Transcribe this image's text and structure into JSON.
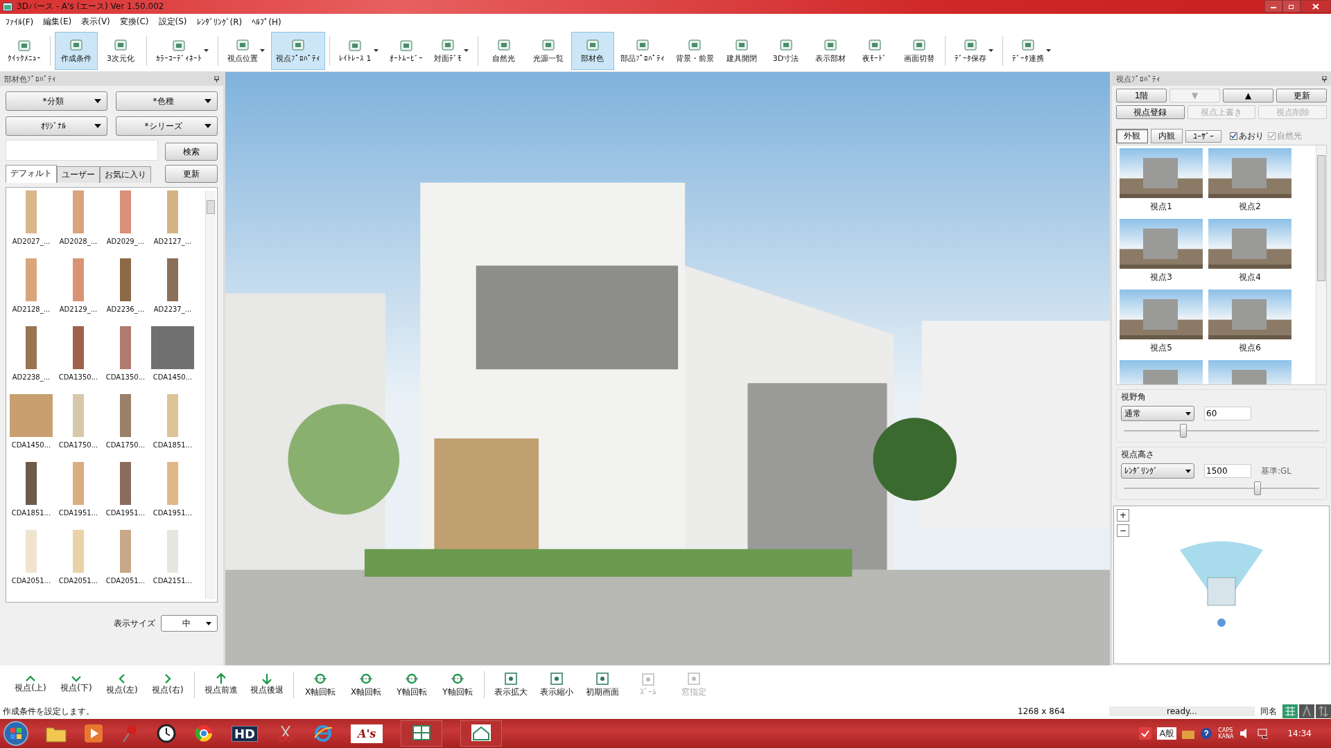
{
  "window": {
    "title": "3Dパース - A's (エース) Ver 1.50.002"
  },
  "menu": [
    "ﾌｧｲﾙ(F)",
    "編集(E)",
    "表示(V)",
    "変換(C)",
    "設定(S)",
    "ﾚﾝﾀﾞﾘﾝｸﾞ(R)",
    "ﾍﾙﾌﾟ(H)"
  ],
  "toolbar": [
    [
      {
        "label": "ｸｲｯｸﾒﾆｭｰ",
        "selected": false,
        "dropdown": false
      }
    ],
    [
      {
        "label": "作成条件",
        "selected": true,
        "dropdown": false
      },
      {
        "label": "3次元化",
        "selected": false,
        "dropdown": false
      }
    ],
    [
      {
        "label": "ｶﾗｰｺｰﾃﾞｨﾈｰﾄ",
        "selected": false,
        "dropdown": true
      }
    ],
    [
      {
        "label": "視点位置",
        "selected": false,
        "dropdown": true
      },
      {
        "label": "視点ﾌﾟﾛﾊﾟﾃｨ",
        "selected": true,
        "dropdown": false
      }
    ],
    [
      {
        "label": "ﾚｲﾄﾚｰｽ 1",
        "selected": false,
        "dropdown": true
      },
      {
        "label": "ｵｰﾄﾑｰﾋﾞｰ",
        "selected": false,
        "dropdown": false
      },
      {
        "label": "対面ﾃﾞﾓ",
        "selected": false,
        "dropdown": true
      }
    ],
    [
      {
        "label": "自然光",
        "selected": false,
        "dropdown": false
      },
      {
        "label": "光源一覧",
        "selected": false,
        "dropdown": false
      },
      {
        "label": "部材色",
        "selected": true,
        "dropdown": false
      },
      {
        "label": "部品ﾌﾟﾛﾊﾟﾃｨ",
        "selected": false,
        "dropdown": false
      },
      {
        "label": "背景・前景",
        "selected": false,
        "dropdown": false
      },
      {
        "label": "建具開閉",
        "selected": false,
        "dropdown": false
      },
      {
        "label": "3D寸法",
        "selected": false,
        "dropdown": false
      },
      {
        "label": "表示部材",
        "selected": false,
        "dropdown": false
      },
      {
        "label": "夜ﾓｰﾄﾞ",
        "selected": false,
        "dropdown": false
      },
      {
        "label": "画面切替",
        "selected": false,
        "dropdown": false
      }
    ],
    [
      {
        "label": "ﾃﾞｰﾀ保存",
        "selected": false,
        "dropdown": true
      }
    ],
    [
      {
        "label": "ﾃﾞｰﾀ連携",
        "selected": false,
        "dropdown": true
      }
    ]
  ],
  "left_panel": {
    "title": "部材色ﾌﾟﾛﾊﾟﾃｨ",
    "dropdowns": [
      "*分類",
      "*色種",
      "ｵﾘｼﾞﾅﾙ",
      "*シリーズ"
    ],
    "search_button": "検索",
    "refresh_button": "更新",
    "tabs": [
      {
        "label": "デフォルト",
        "selected": true
      },
      {
        "label": "ユーザー",
        "selected": false
      },
      {
        "label": "お気に入り",
        "selected": false
      }
    ],
    "swatches": [
      {
        "label": "AD2027_...",
        "color": "#d8b88a",
        "kind": "strip"
      },
      {
        "label": "AD2028_...",
        "color": "#d9a47c",
        "kind": "strip"
      },
      {
        "label": "AD2029_...",
        "color": "#d98f78",
        "kind": "strip"
      },
      {
        "label": "AD2127_...",
        "color": "#d6b384",
        "kind": "strip"
      },
      {
        "label": "AD2128_...",
        "color": "#d9a67c",
        "kind": "strip"
      },
      {
        "label": "AD2129_...",
        "color": "#d99475",
        "kind": "strip"
      },
      {
        "label": "AD2236_...",
        "color": "#8c6a48",
        "kind": "strip"
      },
      {
        "label": "AD2237_...",
        "color": "#8a7058",
        "kind": "strip"
      },
      {
        "label": "AD2238_...",
        "color": "#9a7450",
        "kind": "strip"
      },
      {
        "label": "CDA1350...",
        "color": "#a0604c",
        "kind": "strip"
      },
      {
        "label": "CDA1350...",
        "color": "#b07a6e",
        "kind": "strip"
      },
      {
        "label": "CDA1450...",
        "color": "#707070",
        "kind": "full"
      },
      {
        "label": "CDA1450...",
        "color": "#c8a070",
        "kind": "full"
      },
      {
        "label": "CDA1750...",
        "color": "#d8c8aa",
        "kind": "strip"
      },
      {
        "label": "CDA1750...",
        "color": "#9a8068",
        "kind": "strip"
      },
      {
        "label": "CDA1851...",
        "color": "#dcc498",
        "kind": "strip"
      },
      {
        "label": "CDA1851...",
        "color": "#6e5a4a",
        "kind": "strip"
      },
      {
        "label": "CDA1951...",
        "color": "#d8ad80",
        "kind": "strip"
      },
      {
        "label": "CDA1951...",
        "color": "#8a6c5c",
        "kind": "strip"
      },
      {
        "label": "CDA1951...",
        "color": "#e0b888",
        "kind": "strip"
      },
      {
        "label": "CDA2051...",
        "color": "#f0e4d0",
        "kind": "strip"
      },
      {
        "label": "CDA2051...",
        "color": "#ead2a8",
        "kind": "strip"
      },
      {
        "label": "CDA2051...",
        "color": "#c8a888",
        "kind": "strip"
      },
      {
        "label": "CDA2151...",
        "color": "#e6e6de",
        "kind": "strip"
      }
    ],
    "size_label": "表示サイズ",
    "size_value": "中"
  },
  "right_panel": {
    "title": "視点ﾌﾟﾛﾊﾟﾃｨ",
    "buttons_row1": [
      {
        "label": "1階",
        "disabled": false
      },
      {
        "label": "▼",
        "disabled": true
      },
      {
        "label": "▲",
        "disabled": false
      },
      {
        "label": "更新",
        "disabled": false
      }
    ],
    "buttons_row2": [
      {
        "label": "視点登録",
        "disabled": false
      },
      {
        "label": "視点上書き",
        "disabled": true
      },
      {
        "label": "視点削除",
        "disabled": true
      }
    ],
    "tabs": [
      {
        "label": "外観",
        "selected": true
      },
      {
        "label": "内観",
        "selected": false
      },
      {
        "label": "ﾕｰｻﾞｰ",
        "selected": false
      }
    ],
    "checkboxes": [
      {
        "label": "あおり",
        "checked": true,
        "disabled": false
      },
      {
        "label": "自然光",
        "checked": true,
        "disabled": true
      }
    ],
    "viewpoints": [
      "視点1",
      "視点2",
      "視点3",
      "視点4",
      "視点5",
      "視点6"
    ],
    "fov": {
      "title": "視野角",
      "mode": "通常",
      "value": "60",
      "level": 0.3
    },
    "height": {
      "title": "視点高さ",
      "mode": "ﾚﾝﾀﾞﾘﾝｸﾞ",
      "value": "1500",
      "note": "基準:GL",
      "level": 0.68
    },
    "map_buttons": [
      "+",
      "−"
    ]
  },
  "bottom_toolbar": [
    [
      {
        "label": "視点(上)",
        "disabled": false
      },
      {
        "label": "視点(下)",
        "disabled": false
      },
      {
        "label": "視点(左)",
        "disabled": false
      },
      {
        "label": "視点(右)",
        "disabled": false
      }
    ],
    [
      {
        "label": "視点前進",
        "disabled": false
      },
      {
        "label": "視点後退",
        "disabled": false
      }
    ],
    [
      {
        "label": "X軸回転",
        "disabled": false
      },
      {
        "label": "X軸回転",
        "disabled": false
      },
      {
        "label": "Y軸回転",
        "disabled": false
      },
      {
        "label": "Y軸回転",
        "disabled": false
      }
    ],
    [
      {
        "label": "表示拡大",
        "disabled": false
      },
      {
        "label": "表示縮小",
        "disabled": false
      },
      {
        "label": "初期画面",
        "disabled": false
      },
      {
        "label": "ｽﾞｰﾑ",
        "disabled": true
      },
      {
        "label": "窓指定",
        "disabled": true
      }
    ]
  ],
  "status_bar": {
    "message": "作成条件を設定します。",
    "size": "1268 x 864",
    "state": "ready...",
    "extra": "同名"
  },
  "taskbar": {
    "apps": [
      "HD",
      "A's"
    ],
    "ime": "A般",
    "caps": "CAPS",
    "kana": "KANA",
    "clock": "14:34"
  }
}
